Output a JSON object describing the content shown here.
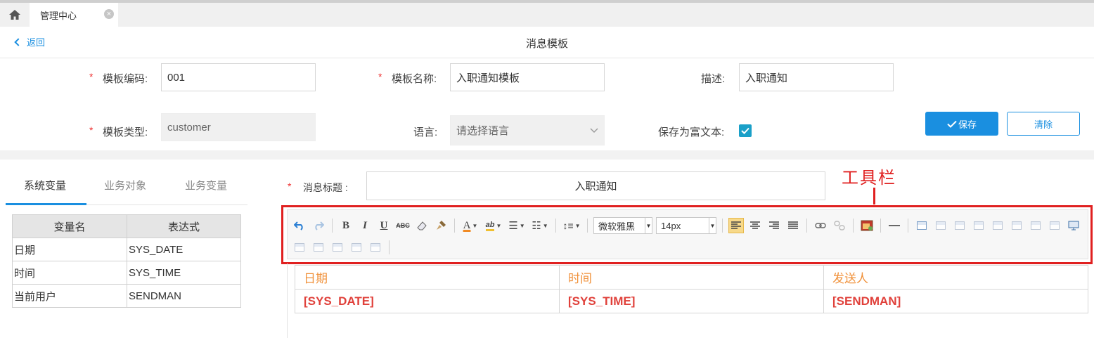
{
  "tabs": {
    "home_icon": "home-icon",
    "active_tab": "管理中心",
    "close_icon": "close-icon"
  },
  "header": {
    "back_label": "返回",
    "title": "消息模板"
  },
  "form": {
    "code_label": "模板编码:",
    "code_value": "001",
    "name_label": "模板名称:",
    "name_value": "入职通知模板",
    "desc_label": "描述:",
    "desc_value": "入职通知",
    "type_label": "模板类型:",
    "type_value": "customer",
    "lang_label": "语言:",
    "lang_placeholder": "请选择语言",
    "richtext_label": "保存为富文本:",
    "richtext_checked": true,
    "required_mark": "*"
  },
  "buttons": {
    "save": "保存",
    "clear": "清除"
  },
  "variables": {
    "tabs": [
      "系统变量",
      "业务对象",
      "业务变量"
    ],
    "columns": [
      "变量名",
      "表达式"
    ],
    "rows": [
      [
        "日期",
        "SYS_DATE"
      ],
      [
        "时间",
        "SYS_TIME"
      ],
      [
        "当前用户",
        "SENDMAN"
      ]
    ]
  },
  "message": {
    "title_label": "消息标题 :",
    "title_value": "入职通知"
  },
  "annotation": {
    "text": "工具栏"
  },
  "toolbar": {
    "font_family": "微软雅黑",
    "font_size": "14px",
    "bold": "B",
    "italic": "I",
    "underline": "U",
    "strike": "ABC"
  },
  "content": {
    "headers": [
      "日期",
      "时间",
      "发送人"
    ],
    "values": [
      "[SYS_DATE]",
      "[SYS_TIME]",
      "[SENDMAN]"
    ]
  },
  "colors": {
    "accent": "#1a8fe0",
    "required": "#e33333",
    "annotation": "#e02020",
    "header_text": "#f0913a",
    "value_text": "#e0403a"
  }
}
